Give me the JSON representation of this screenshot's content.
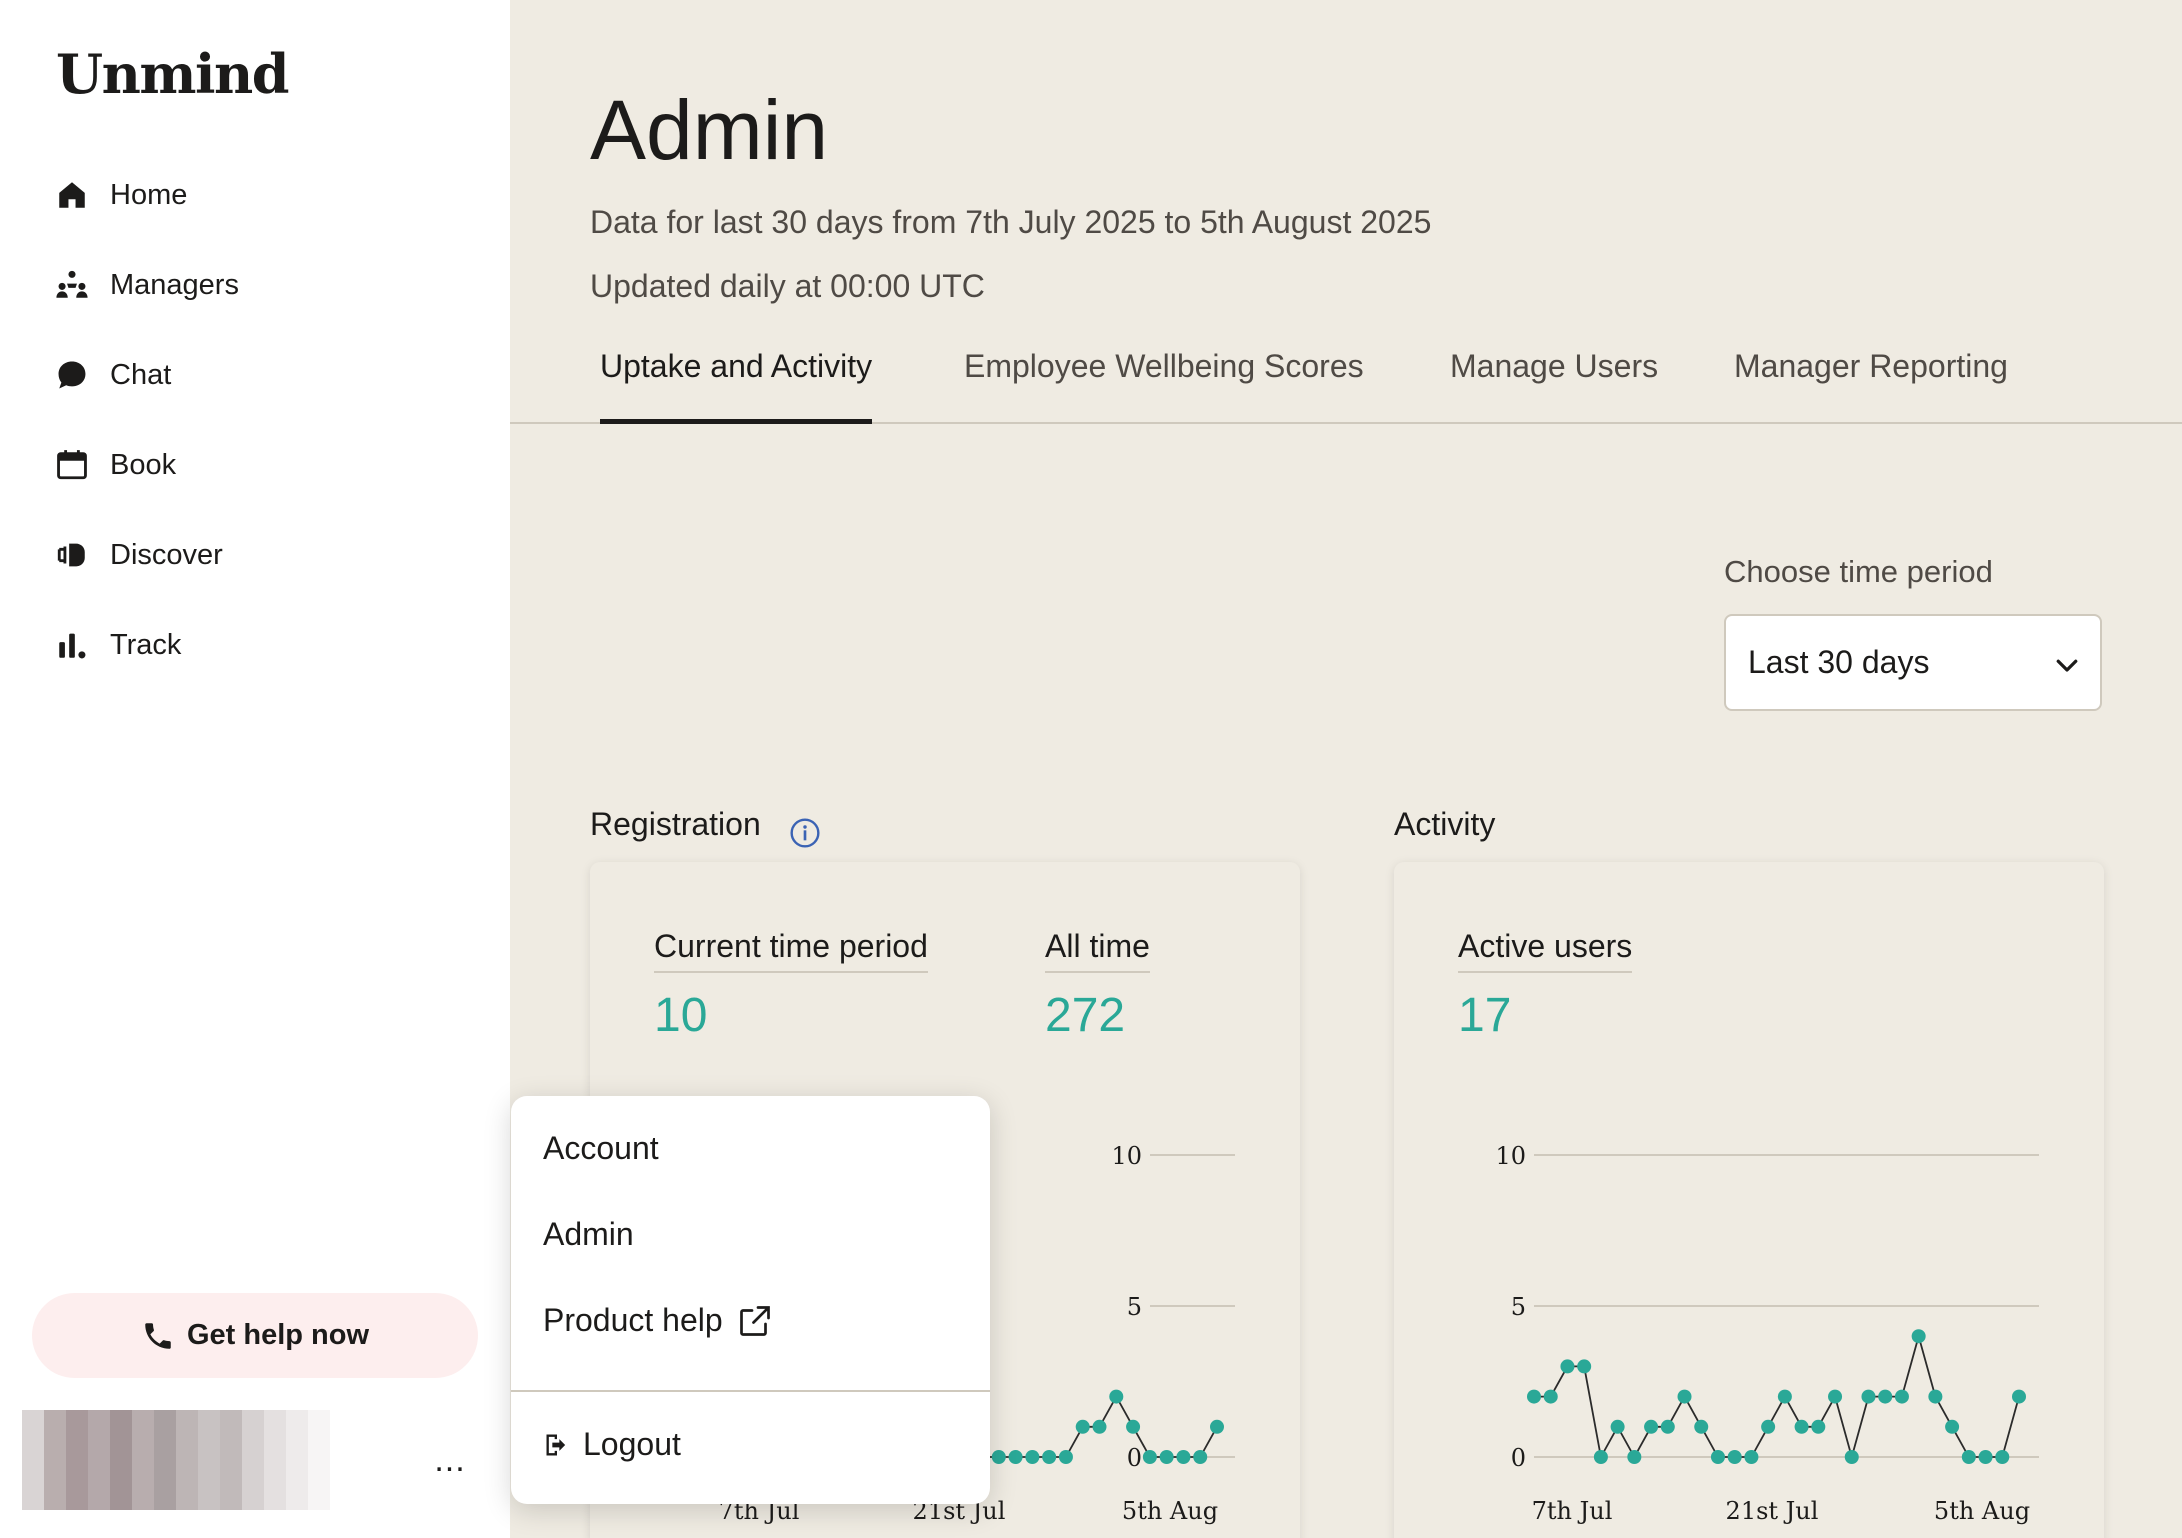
{
  "brand": {
    "logo": "Unmind"
  },
  "sidebar": {
    "items": [
      {
        "label": "Home",
        "icon": "home-icon"
      },
      {
        "label": "Managers",
        "icon": "managers-icon"
      },
      {
        "label": "Chat",
        "icon": "chat-icon"
      },
      {
        "label": "Book",
        "icon": "calendar-icon"
      },
      {
        "label": "Discover",
        "icon": "discover-icon"
      },
      {
        "label": "Track",
        "icon": "bar-chart-icon"
      }
    ],
    "help_button": "Get help now",
    "more_label": "..."
  },
  "header": {
    "title": "Admin",
    "date_range": "Data for last 30 days from 7th July 2025 to 5th August 2025",
    "update_note": "Updated daily at 00:00 UTC"
  },
  "tabs": [
    {
      "label": "Uptake and Activity",
      "active": true
    },
    {
      "label": "Employee Wellbeing Scores",
      "active": false
    },
    {
      "label": "Manage Users",
      "active": false
    },
    {
      "label": "Manager Reporting",
      "active": false
    }
  ],
  "time_period": {
    "label": "Choose time period",
    "selected": "Last 30 days"
  },
  "registration": {
    "title": "Registration",
    "current_label": "Current time period",
    "current_value": "10",
    "alltime_label": "All time",
    "alltime_value": "272"
  },
  "activity": {
    "title": "Activity",
    "active_label": "Active users",
    "active_value": "17"
  },
  "user_menu": {
    "items": [
      "Account",
      "Admin",
      "Product help"
    ],
    "logout": "Logout"
  },
  "colors": {
    "accent": "#2aa897",
    "background": "#efebe2",
    "help_button_bg": "#fdeeee"
  },
  "chart_data": [
    {
      "type": "line",
      "title": "Registration",
      "x_tick_labels": [
        "7th Jul",
        "21st Jul",
        "5th Aug"
      ],
      "y_ticks": [
        0,
        5,
        10
      ],
      "ylim": [
        0,
        10
      ],
      "note": "partially hidden by menu; only the right-hand portion of the line is visible",
      "series": [
        {
          "values": [
            0,
            0,
            0,
            0,
            0,
            0,
            1,
            1,
            2,
            1,
            0,
            0,
            0,
            0,
            1
          ]
        }
      ]
    },
    {
      "type": "line",
      "title": "Activity",
      "x_tick_labels": [
        "7th Jul",
        "21st Jul",
        "5th Aug"
      ],
      "y_ticks": [
        0,
        5,
        10
      ],
      "ylim": [
        0,
        10
      ],
      "series": [
        {
          "values": [
            2,
            2,
            3,
            3,
            0,
            1,
            0,
            1,
            1,
            2,
            1,
            0,
            0,
            0,
            1,
            2,
            1,
            1,
            2,
            0,
            2,
            2,
            2,
            4,
            2,
            1,
            0,
            0,
            0,
            2
          ]
        }
      ]
    }
  ]
}
